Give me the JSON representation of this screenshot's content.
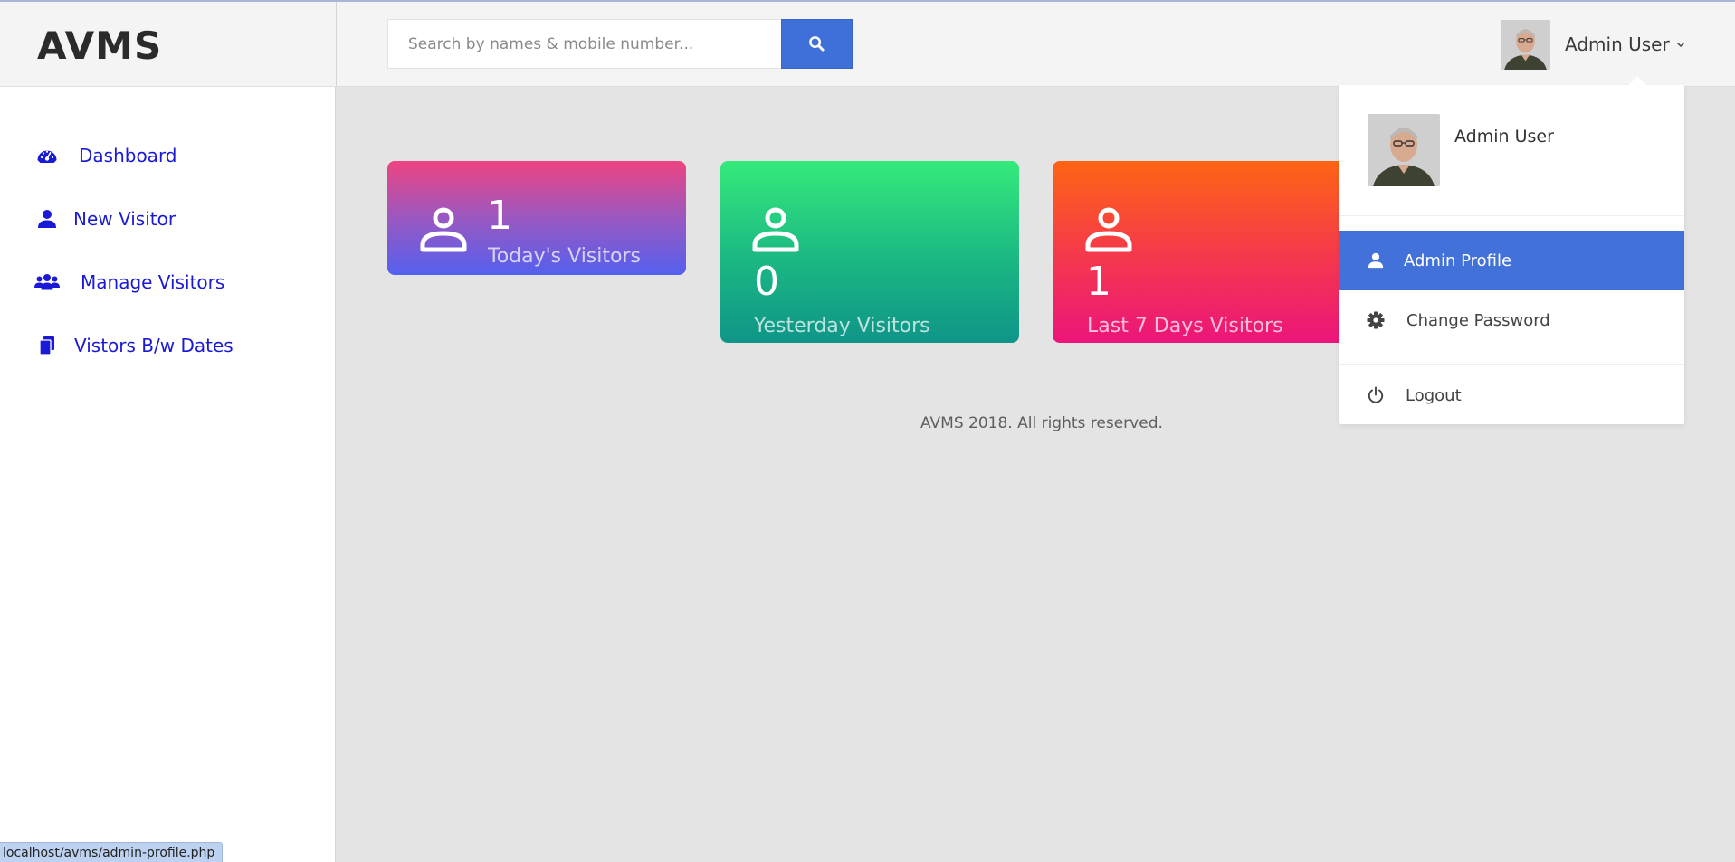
{
  "app": {
    "brand": "AVMS"
  },
  "search": {
    "placeholder": "Search by names & mobile number...",
    "icon": "search-icon"
  },
  "user_menu": {
    "name": "Admin User"
  },
  "sidebar": {
    "items": [
      {
        "label": "Dashboard",
        "icon": "tachometer-icon"
      },
      {
        "label": "New Visitor",
        "icon": "user-icon"
      },
      {
        "label": "Manage Visitors",
        "icon": "users-icon"
      },
      {
        "label": "Vistors B/w Dates",
        "icon": "files-icon"
      }
    ]
  },
  "stats": {
    "today": {
      "value": "1",
      "label": "Today's Visitors"
    },
    "yesterday": {
      "value": "0",
      "label": "Yesterday Visitors"
    },
    "last7": {
      "value": "1",
      "label": "Last 7 Days Visitors"
    }
  },
  "footer": {
    "text": "AVMS 2018. All rights reserved."
  },
  "dropdown": {
    "name": "Admin User",
    "items": [
      {
        "label": "Admin Profile",
        "icon": "user-icon",
        "active": true
      },
      {
        "label": "Change Password",
        "icon": "gear-icon",
        "active": false
      },
      {
        "label": "Logout",
        "icon": "power-icon",
        "active": false
      }
    ]
  },
  "status_bar": {
    "url": "localhost/avms/admin-profile.php"
  },
  "colors": {
    "accent": "#4271d9",
    "nav_link": "#1a1ad6",
    "card_today": [
      "#ee4481",
      "#5460ef"
    ],
    "card_yesterday": [
      "#35ea7b",
      "#0f9588"
    ],
    "card_last7": [
      "#fe6413",
      "#ec157b"
    ]
  }
}
